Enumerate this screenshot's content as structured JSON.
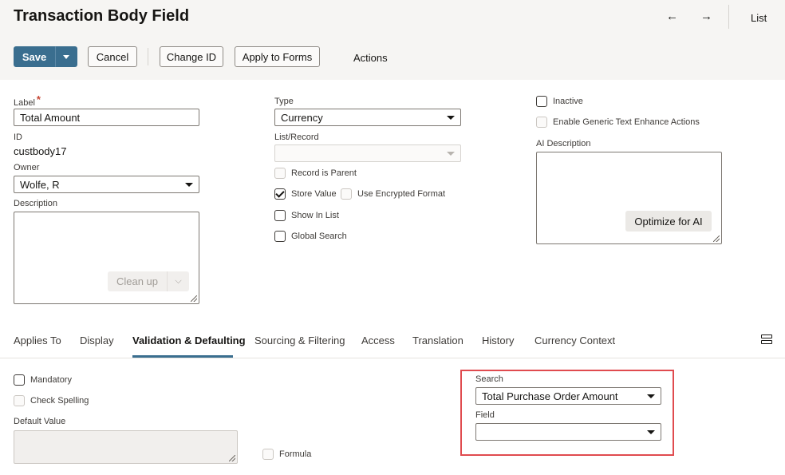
{
  "header": {
    "title": "Transaction Body Field",
    "back_icon": "←",
    "forward_icon": "→",
    "list_label": "List"
  },
  "toolbar": {
    "save_label": "Save",
    "cancel_label": "Cancel",
    "change_id_label": "Change ID",
    "apply_to_forms_label": "Apply to Forms",
    "actions_label": "Actions"
  },
  "form": {
    "label_label": "Label",
    "label_required_marker": "*",
    "label_value": "Total Amount",
    "id_label": "ID",
    "id_value": "custbody17",
    "owner_label": "Owner",
    "owner_value": "Wolfe, R",
    "description_label": "Description",
    "clean_up_label": "Clean up",
    "type_label": "Type",
    "type_value": "Currency",
    "list_record_label": "List/Record",
    "list_record_value": "",
    "record_is_parent_label": "Record is Parent",
    "store_value_label": "Store Value",
    "use_encrypted_label": "Use Encrypted Format",
    "show_in_list_label": "Show In List",
    "global_search_label": "Global Search",
    "inactive_label": "Inactive",
    "enable_generic_label": "Enable Generic Text Enhance Actions",
    "ai_description_label": "AI Description",
    "optimize_label": "Optimize for AI"
  },
  "tabs": [
    {
      "label": "Applies To",
      "active": false
    },
    {
      "label": "Display",
      "active": false
    },
    {
      "label": "Validation & Defaulting",
      "active": true
    },
    {
      "label": "Sourcing & Filtering",
      "active": false
    },
    {
      "label": "Access",
      "active": false
    },
    {
      "label": "Translation",
      "active": false
    },
    {
      "label": "History",
      "active": false
    },
    {
      "label": "Currency Context",
      "active": false
    }
  ],
  "validation": {
    "mandatory_label": "Mandatory",
    "check_spelling_label": "Check Spelling",
    "default_value_label": "Default Value",
    "formula_label": "Formula",
    "search_label": "Search",
    "search_value": "Total Purchase Order Amount",
    "field_label": "Field",
    "field_value": ""
  },
  "colors": {
    "primary": "#3a6e8f",
    "highlight": "#e04b4f"
  }
}
